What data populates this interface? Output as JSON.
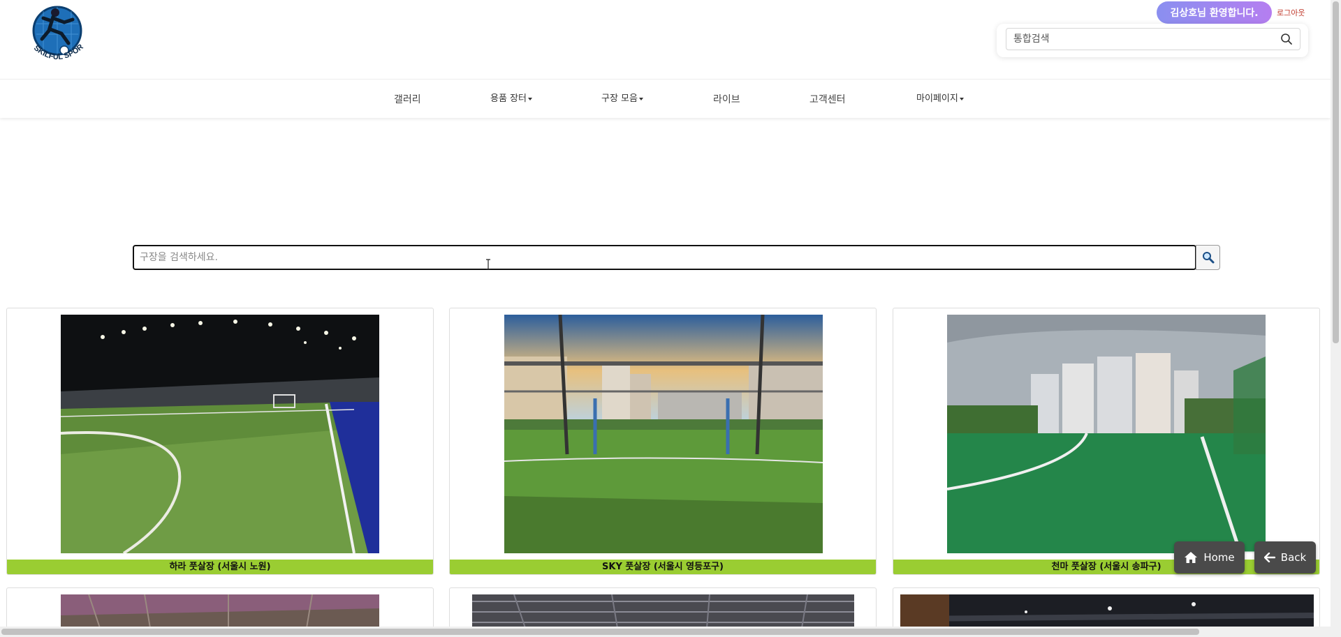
{
  "header": {
    "logo_text": "SKILFUL SPORTS",
    "welcome_text": "김상호님 환영합니다.",
    "logout_label": "로그아웃",
    "search_placeholder": "통합검색"
  },
  "nav": {
    "items": [
      {
        "label": "갤러리",
        "dropdown": false
      },
      {
        "label": "용품 장터",
        "dropdown": true
      },
      {
        "label": "구장 모음",
        "dropdown": true
      },
      {
        "label": "라이브",
        "dropdown": false
      },
      {
        "label": "고객센터",
        "dropdown": false
      },
      {
        "label": "마이페이지",
        "dropdown": true
      }
    ]
  },
  "main": {
    "search_placeholder": "구장을 검색하세요.",
    "fields": [
      {
        "caption": "하라 풋살장 (서울시 노원)"
      },
      {
        "caption": "SKY 풋살장 (서울시 영등포구)"
      },
      {
        "caption": "천마 풋살장 (서울시 송파구)"
      }
    ]
  },
  "floating": {
    "home_label": "Home",
    "back_label": "Back"
  },
  "colors": {
    "caption_bar": "#9acd32",
    "welcome_gradient_start": "#8a8ff0",
    "welcome_gradient_end": "#b57ef0",
    "float_button": "#4a4a4a",
    "logout_text": "#c0392b"
  }
}
